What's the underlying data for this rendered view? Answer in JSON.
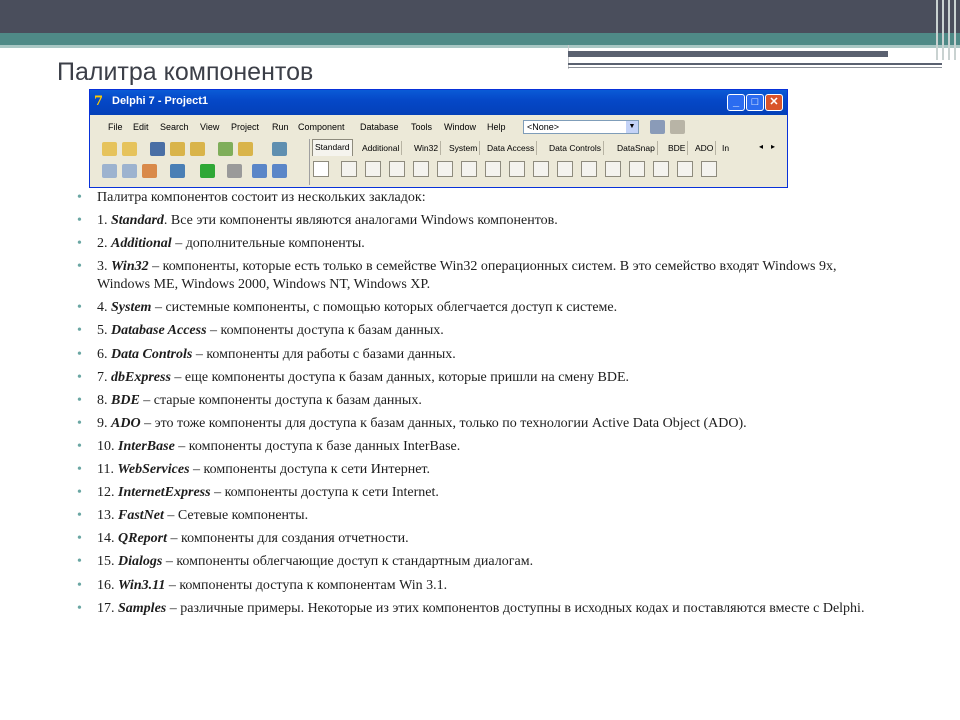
{
  "slide": {
    "title": "Палитра компонентов"
  },
  "window": {
    "title": "Delphi 7 - Project1",
    "logo_glyph": "7",
    "minimize_glyph": "_",
    "maximize_glyph": "□",
    "close_glyph": "✕",
    "menu": [
      "File",
      "Edit",
      "Search",
      "View",
      "Project",
      "Run",
      "Component",
      "Database",
      "Tools",
      "Window",
      "Help"
    ],
    "combo_value": "<None>",
    "palette_tabs": [
      "Standard",
      "Additional",
      "Win32",
      "System",
      "Data Access",
      "Data Controls",
      "DataSnap",
      "BDE",
      "ADO",
      "In"
    ],
    "active_tab": "Standard",
    "scroll_left": "◂",
    "scroll_right": "▸"
  },
  "bullets": [
    {
      "num": "",
      "kw": "",
      "text": "Палитра компонентов состоит из нескольких закладок:"
    },
    {
      "num": "1. ",
      "kw": "Standard",
      "text": ". Все эти компоненты являются аналогами Windows компонентов."
    },
    {
      "num": "2. ",
      "kw": "Additional",
      "text": " – дополнительные компоненты."
    },
    {
      "num": "3. ",
      "kw": "Win32",
      "text": " – компоненты, которые есть только в семействе Win32 операционных систем. В это семейство входят Windows 9x, Windows ME, Windows 2000, Windows NT, Windows XP."
    },
    {
      "num": "4. ",
      "kw": "System",
      "text": " – системные компоненты, с помощью которых облегчается доступ к системе."
    },
    {
      "num": "5. ",
      "kw": "Database Access",
      "text": " – компоненты доступа к базам данных."
    },
    {
      "num": "6. ",
      "kw": "Data Controls",
      "text": " – компоненты для работы с базами данных."
    },
    {
      "num": "7. ",
      "kw": "dbExpress",
      "text": " – еще компоненты доступа к базам данных, которые пришли на смену BDE."
    },
    {
      "num": "8. ",
      "kw": "BDE",
      "text": " – старые компоненты доступа к базам данных."
    },
    {
      "num": "9. ",
      "kw": "ADO",
      "text": " – это тоже компоненты для доступа к базам данных, только по технологии Active Data Object (ADO)."
    },
    {
      "num": "10. ",
      "kw": "InterBase",
      "text": " – компоненты доступа к базе данных InterBase."
    },
    {
      "num": "11. ",
      "kw": "WebServices",
      "text": " – компоненты доступа к сети Интернет."
    },
    {
      "num": "12. ",
      "kw": "InternetExpress",
      "text": " – компоненты доступа к сети Internet."
    },
    {
      "num": "13. ",
      "kw": "FastNet",
      "text": " – Сетевые компоненты."
    },
    {
      "num": "14. ",
      "kw": "QReport",
      "text": " – компоненты для создания отчетности."
    },
    {
      "num": "15. ",
      "kw": "Dialogs",
      "text": " – компоненты облегчающие доступ к стандартным диалогам."
    },
    {
      "num": "16. ",
      "kw": "Win3.11",
      "text": " – компоненты доступа к компонентам Win 3.1."
    },
    {
      "num": "17. ",
      "kw": "Samples",
      "text": " – различные примеры. Некоторые из этих компонентов доступны в исходных кодах и поставляются вместе с Delphi."
    }
  ],
  "colors": {
    "bullet": "#6aa6a3",
    "header_dark": "#4a4e5c",
    "header_teal": "#4f8a87",
    "xp_title": "#0548c8"
  }
}
